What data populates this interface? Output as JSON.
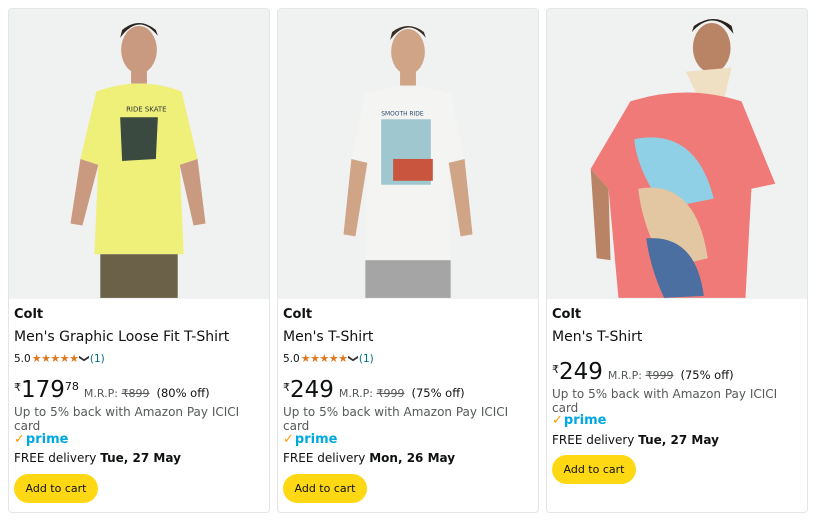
{
  "products": [
    {
      "brand": "Colt",
      "title": "Men's Graphic Loose Fit T-Shirt",
      "rating_value": "5.0",
      "stars": "★★★★★",
      "rating_count": "(1)",
      "currency": "₹",
      "price_whole": "179",
      "price_fraction": "78",
      "mrp_label": "M.R.P:",
      "mrp_value": "₹899",
      "discount": "(80% off)",
      "cashback": "Up to 5% back with Amazon Pay ICICI card",
      "prime_label": "prime",
      "delivery_prefix": "FREE delivery",
      "delivery_date": "Tue, 27 May",
      "add_to_cart": "Add to cart",
      "shirt_color": "#eef07a"
    },
    {
      "brand": "Colt",
      "title": "Men's T-Shirt",
      "rating_value": "5.0",
      "stars": "★★★★★",
      "rating_count": "(1)",
      "currency": "₹",
      "price_whole": "249",
      "mrp_label": "M.R.P:",
      "mrp_value": "₹999",
      "discount": "(75% off)",
      "cashback": "Up to 5% back with Amazon Pay ICICI card",
      "prime_label": "prime",
      "delivery_prefix": "FREE delivery",
      "delivery_date": "Mon, 26 May",
      "add_to_cart": "Add to cart",
      "shirt_color": "#f4f4f2"
    },
    {
      "brand": "Colt",
      "title": "Men's T-Shirt",
      "currency": "₹",
      "price_whole": "249",
      "mrp_label": "M.R.P:",
      "mrp_value": "₹999",
      "discount": "(75% off)",
      "cashback": "Up to 5% back with Amazon Pay ICICI card",
      "prime_label": "prime",
      "delivery_prefix": "FREE delivery",
      "delivery_date": "Tue, 27 May",
      "add_to_cart": "Add to cart",
      "shirt_color": "#f07a78"
    }
  ],
  "colors": {
    "button": "#ffd814",
    "star": "#de7921",
    "prime": "#00a8e1",
    "link": "#007185"
  }
}
